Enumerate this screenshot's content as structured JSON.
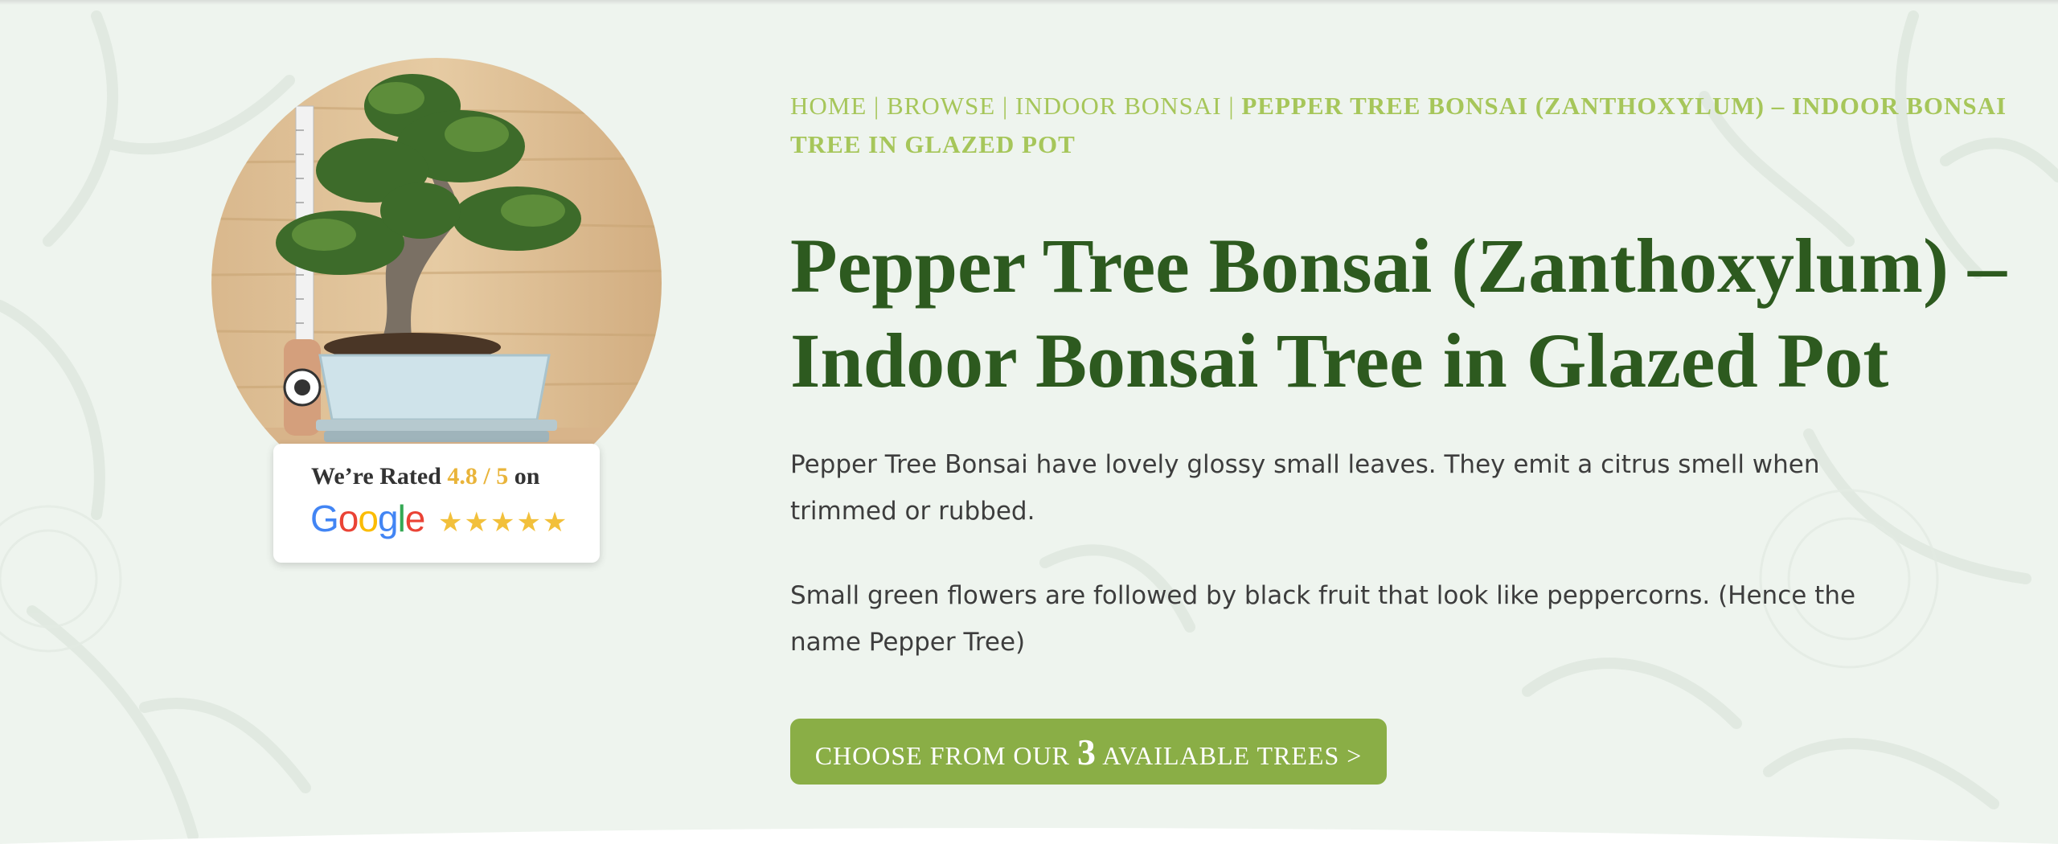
{
  "colors": {
    "background": "#eef4ee",
    "breadcrumb": "#a6c65a",
    "title": "#2d5a1f",
    "body_text": "#3d3d3d",
    "cta_background": "#8aae46",
    "rating_highlight": "#e9b43a"
  },
  "breadcrumb": {
    "items": [
      "HOME",
      "BROWSE",
      "INDOOR BONSAI"
    ],
    "separator": "|",
    "current": "PEPPER TREE BONSAI (ZANTHOXYLUM) – INDOOR BONSAI TREE IN GLAZED POT"
  },
  "product": {
    "title_line1": "Pepper Tree Bonsai (Zanthoxylum) –",
    "title_line2": "Indoor Bonsai Tree in Glazed Pot",
    "description": [
      "Pepper Tree Bonsai have lovely glossy small leaves. They emit a citrus smell when trimmed or rubbed.",
      "Small green flowers are followed by black fruit that look like peppercorns. (Hence the name Pepper Tree)"
    ],
    "image_icon": "bonsai-tree-photo"
  },
  "rating": {
    "prefix": "We’re Rated",
    "score": "4.8 / 5",
    "suffix": "on",
    "brand": "Google",
    "stars": 4.8,
    "star_glyphs": "★★★★★"
  },
  "cta": {
    "before": "CHOOSE FROM OUR",
    "count": "3",
    "after": "AVAILABLE TREES >"
  }
}
